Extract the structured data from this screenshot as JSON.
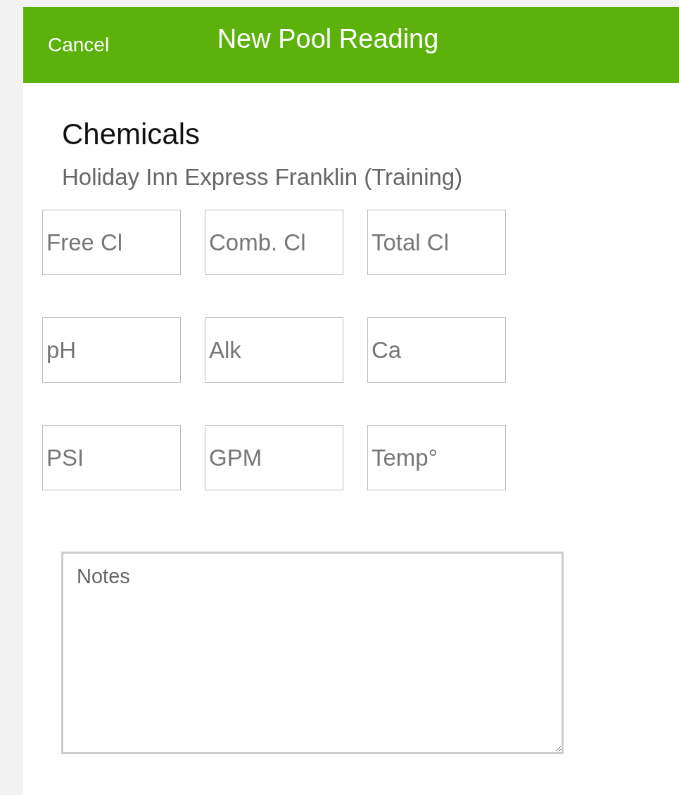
{
  "header": {
    "cancel": "Cancel",
    "title": "New Pool Reading"
  },
  "section": {
    "title": "Chemicals",
    "subtitle": "Holiday Inn Express Franklin (Training)"
  },
  "field_rows": [
    {
      "fields": [
        {
          "placeholder": "Free Cl"
        },
        {
          "placeholder": "Comb. Cl"
        },
        {
          "placeholder": "Total Cl"
        }
      ]
    },
    {
      "fields": [
        {
          "placeholder": "pH"
        },
        {
          "placeholder": "Alk"
        },
        {
          "placeholder": "Ca"
        }
      ]
    },
    {
      "fields": [
        {
          "placeholder": "PSI"
        },
        {
          "placeholder": "GPM"
        },
        {
          "placeholder": "Temp°"
        }
      ]
    }
  ],
  "notes": {
    "placeholder": "Notes"
  }
}
